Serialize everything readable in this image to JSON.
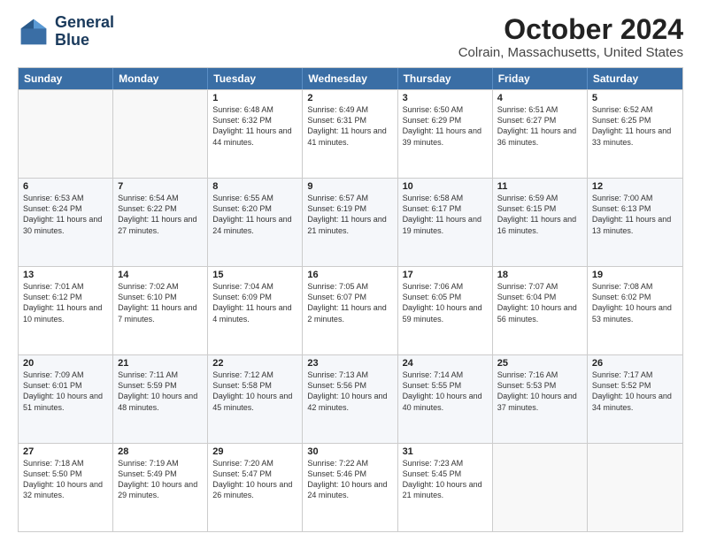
{
  "logo": {
    "line1": "General",
    "line2": "Blue"
  },
  "title": "October 2024",
  "location": "Colrain, Massachusetts, United States",
  "weekdays": [
    "Sunday",
    "Monday",
    "Tuesday",
    "Wednesday",
    "Thursday",
    "Friday",
    "Saturday"
  ],
  "weeks": [
    [
      {
        "day": "",
        "sunrise": "",
        "sunset": "",
        "daylight": ""
      },
      {
        "day": "",
        "sunrise": "",
        "sunset": "",
        "daylight": ""
      },
      {
        "day": "1",
        "sunrise": "Sunrise: 6:48 AM",
        "sunset": "Sunset: 6:32 PM",
        "daylight": "Daylight: 11 hours and 44 minutes."
      },
      {
        "day": "2",
        "sunrise": "Sunrise: 6:49 AM",
        "sunset": "Sunset: 6:31 PM",
        "daylight": "Daylight: 11 hours and 41 minutes."
      },
      {
        "day": "3",
        "sunrise": "Sunrise: 6:50 AM",
        "sunset": "Sunset: 6:29 PM",
        "daylight": "Daylight: 11 hours and 39 minutes."
      },
      {
        "day": "4",
        "sunrise": "Sunrise: 6:51 AM",
        "sunset": "Sunset: 6:27 PM",
        "daylight": "Daylight: 11 hours and 36 minutes."
      },
      {
        "day": "5",
        "sunrise": "Sunrise: 6:52 AM",
        "sunset": "Sunset: 6:25 PM",
        "daylight": "Daylight: 11 hours and 33 minutes."
      }
    ],
    [
      {
        "day": "6",
        "sunrise": "Sunrise: 6:53 AM",
        "sunset": "Sunset: 6:24 PM",
        "daylight": "Daylight: 11 hours and 30 minutes."
      },
      {
        "day": "7",
        "sunrise": "Sunrise: 6:54 AM",
        "sunset": "Sunset: 6:22 PM",
        "daylight": "Daylight: 11 hours and 27 minutes."
      },
      {
        "day": "8",
        "sunrise": "Sunrise: 6:55 AM",
        "sunset": "Sunset: 6:20 PM",
        "daylight": "Daylight: 11 hours and 24 minutes."
      },
      {
        "day": "9",
        "sunrise": "Sunrise: 6:57 AM",
        "sunset": "Sunset: 6:19 PM",
        "daylight": "Daylight: 11 hours and 21 minutes."
      },
      {
        "day": "10",
        "sunrise": "Sunrise: 6:58 AM",
        "sunset": "Sunset: 6:17 PM",
        "daylight": "Daylight: 11 hours and 19 minutes."
      },
      {
        "day": "11",
        "sunrise": "Sunrise: 6:59 AM",
        "sunset": "Sunset: 6:15 PM",
        "daylight": "Daylight: 11 hours and 16 minutes."
      },
      {
        "day": "12",
        "sunrise": "Sunrise: 7:00 AM",
        "sunset": "Sunset: 6:13 PM",
        "daylight": "Daylight: 11 hours and 13 minutes."
      }
    ],
    [
      {
        "day": "13",
        "sunrise": "Sunrise: 7:01 AM",
        "sunset": "Sunset: 6:12 PM",
        "daylight": "Daylight: 11 hours and 10 minutes."
      },
      {
        "day": "14",
        "sunrise": "Sunrise: 7:02 AM",
        "sunset": "Sunset: 6:10 PM",
        "daylight": "Daylight: 11 hours and 7 minutes."
      },
      {
        "day": "15",
        "sunrise": "Sunrise: 7:04 AM",
        "sunset": "Sunset: 6:09 PM",
        "daylight": "Daylight: 11 hours and 4 minutes."
      },
      {
        "day": "16",
        "sunrise": "Sunrise: 7:05 AM",
        "sunset": "Sunset: 6:07 PM",
        "daylight": "Daylight: 11 hours and 2 minutes."
      },
      {
        "day": "17",
        "sunrise": "Sunrise: 7:06 AM",
        "sunset": "Sunset: 6:05 PM",
        "daylight": "Daylight: 10 hours and 59 minutes."
      },
      {
        "day": "18",
        "sunrise": "Sunrise: 7:07 AM",
        "sunset": "Sunset: 6:04 PM",
        "daylight": "Daylight: 10 hours and 56 minutes."
      },
      {
        "day": "19",
        "sunrise": "Sunrise: 7:08 AM",
        "sunset": "Sunset: 6:02 PM",
        "daylight": "Daylight: 10 hours and 53 minutes."
      }
    ],
    [
      {
        "day": "20",
        "sunrise": "Sunrise: 7:09 AM",
        "sunset": "Sunset: 6:01 PM",
        "daylight": "Daylight: 10 hours and 51 minutes."
      },
      {
        "day": "21",
        "sunrise": "Sunrise: 7:11 AM",
        "sunset": "Sunset: 5:59 PM",
        "daylight": "Daylight: 10 hours and 48 minutes."
      },
      {
        "day": "22",
        "sunrise": "Sunrise: 7:12 AM",
        "sunset": "Sunset: 5:58 PM",
        "daylight": "Daylight: 10 hours and 45 minutes."
      },
      {
        "day": "23",
        "sunrise": "Sunrise: 7:13 AM",
        "sunset": "Sunset: 5:56 PM",
        "daylight": "Daylight: 10 hours and 42 minutes."
      },
      {
        "day": "24",
        "sunrise": "Sunrise: 7:14 AM",
        "sunset": "Sunset: 5:55 PM",
        "daylight": "Daylight: 10 hours and 40 minutes."
      },
      {
        "day": "25",
        "sunrise": "Sunrise: 7:16 AM",
        "sunset": "Sunset: 5:53 PM",
        "daylight": "Daylight: 10 hours and 37 minutes."
      },
      {
        "day": "26",
        "sunrise": "Sunrise: 7:17 AM",
        "sunset": "Sunset: 5:52 PM",
        "daylight": "Daylight: 10 hours and 34 minutes."
      }
    ],
    [
      {
        "day": "27",
        "sunrise": "Sunrise: 7:18 AM",
        "sunset": "Sunset: 5:50 PM",
        "daylight": "Daylight: 10 hours and 32 minutes."
      },
      {
        "day": "28",
        "sunrise": "Sunrise: 7:19 AM",
        "sunset": "Sunset: 5:49 PM",
        "daylight": "Daylight: 10 hours and 29 minutes."
      },
      {
        "day": "29",
        "sunrise": "Sunrise: 7:20 AM",
        "sunset": "Sunset: 5:47 PM",
        "daylight": "Daylight: 10 hours and 26 minutes."
      },
      {
        "day": "30",
        "sunrise": "Sunrise: 7:22 AM",
        "sunset": "Sunset: 5:46 PM",
        "daylight": "Daylight: 10 hours and 24 minutes."
      },
      {
        "day": "31",
        "sunrise": "Sunrise: 7:23 AM",
        "sunset": "Sunset: 5:45 PM",
        "daylight": "Daylight: 10 hours and 21 minutes."
      },
      {
        "day": "",
        "sunrise": "",
        "sunset": "",
        "daylight": ""
      },
      {
        "day": "",
        "sunrise": "",
        "sunset": "",
        "daylight": ""
      }
    ]
  ]
}
